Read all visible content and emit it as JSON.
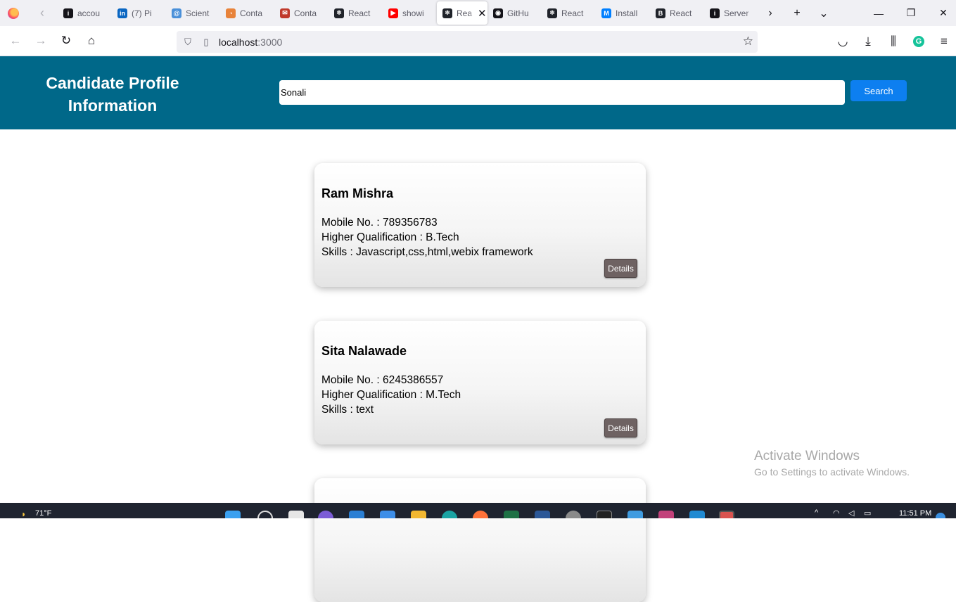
{
  "browser": {
    "tabs": [
      {
        "title": "accou",
        "icon": "info-icon",
        "color": "#15141a"
      },
      {
        "title": "(7) Pi",
        "icon": "linkedin-icon",
        "color": "#0a66c2"
      },
      {
        "title": "Scient",
        "icon": "spiral-icon",
        "color": "#4a90d9"
      },
      {
        "title": "Conta",
        "icon": "chart-pie-icon",
        "color": "#e8833a"
      },
      {
        "title": "Conta",
        "icon": "mail-icon",
        "color": "#c0392b"
      },
      {
        "title": "React",
        "icon": "react-icon",
        "color": "#20232a"
      },
      {
        "title": "showi",
        "icon": "youtube-icon",
        "color": "#ff0000"
      },
      {
        "title": "Rea",
        "icon": "react-icon",
        "color": "#20232a",
        "active": true
      },
      {
        "title": "GitHu",
        "icon": "github-icon",
        "color": "#15141a"
      },
      {
        "title": "React",
        "icon": "react-icon",
        "color": "#20232a"
      },
      {
        "title": "Install",
        "icon": "mui-icon",
        "color": "#007fff"
      },
      {
        "title": "React",
        "icon": "react-bootstrap-icon",
        "color": "#20232a"
      },
      {
        "title": "Server",
        "icon": "info-icon",
        "color": "#15141a"
      }
    ],
    "url_host": "localhost",
    "url_port": ":3000"
  },
  "app": {
    "title": "Candidate Profile Information",
    "search_value": "Sonali",
    "search_button": "Search"
  },
  "candidates": [
    {
      "name": "Ram Mishra",
      "mobile": "Mobile No. : 789356783",
      "qualification": "Higher Qualification : B.Tech",
      "skills": "Skills : Javascript,css,html,webix framework",
      "details_label": "Details"
    },
    {
      "name": "Sita Nalawade",
      "mobile": "Mobile No. : 6245386557",
      "qualification": "Higher Qualification : M.Tech",
      "skills": "Skills : text",
      "details_label": "Details"
    },
    {
      "name": "",
      "mobile": "",
      "qualification": "",
      "skills": "",
      "details_label": ""
    }
  ],
  "watermark": {
    "line1": "Activate Windows",
    "line2": "Go to Settings to activate Windows."
  },
  "taskbar": {
    "weather": "71°F",
    "time": "11:51 PM"
  }
}
